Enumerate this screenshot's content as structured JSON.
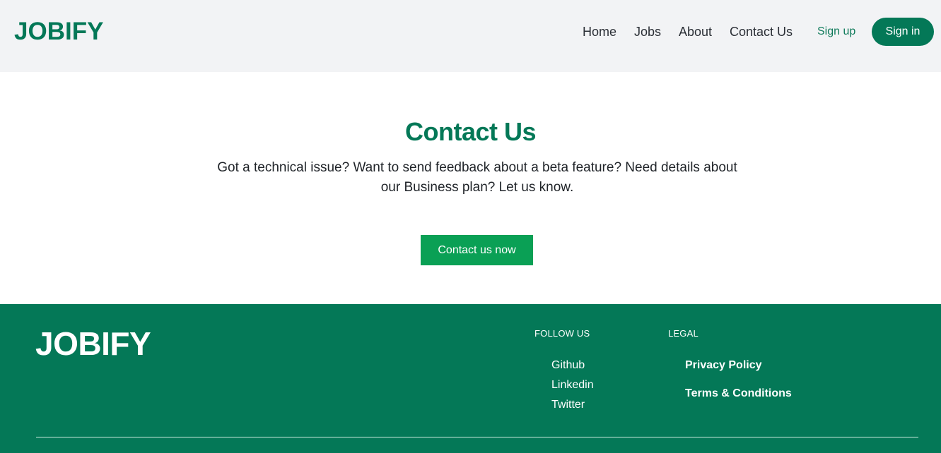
{
  "header": {
    "brand": "JOBIFY",
    "nav": [
      {
        "label": "Home"
      },
      {
        "label": "Jobs"
      },
      {
        "label": "About"
      },
      {
        "label": "Contact Us"
      }
    ],
    "signup_label": "Sign up",
    "signin_label": "Sign in"
  },
  "hero": {
    "title": "Contact Us",
    "description": "Got a technical issue? Want to send feedback about a beta feature? Need details about our Business plan? Let us know.",
    "cta_label": "Contact us now"
  },
  "footer": {
    "brand": "JOBIFY",
    "follow": {
      "title": "FOLLOW US",
      "links": [
        {
          "label": "Github"
        },
        {
          "label": "Linkedin"
        },
        {
          "label": "Twitter"
        }
      ]
    },
    "legal": {
      "title": "LEGAL",
      "links": [
        {
          "label": "Privacy Policy"
        },
        {
          "label": "Terms & Conditions"
        }
      ]
    }
  },
  "colors": {
    "brand_green": "#047857",
    "cta_green": "#0aa055",
    "header_bg": "#f2f3f5"
  }
}
